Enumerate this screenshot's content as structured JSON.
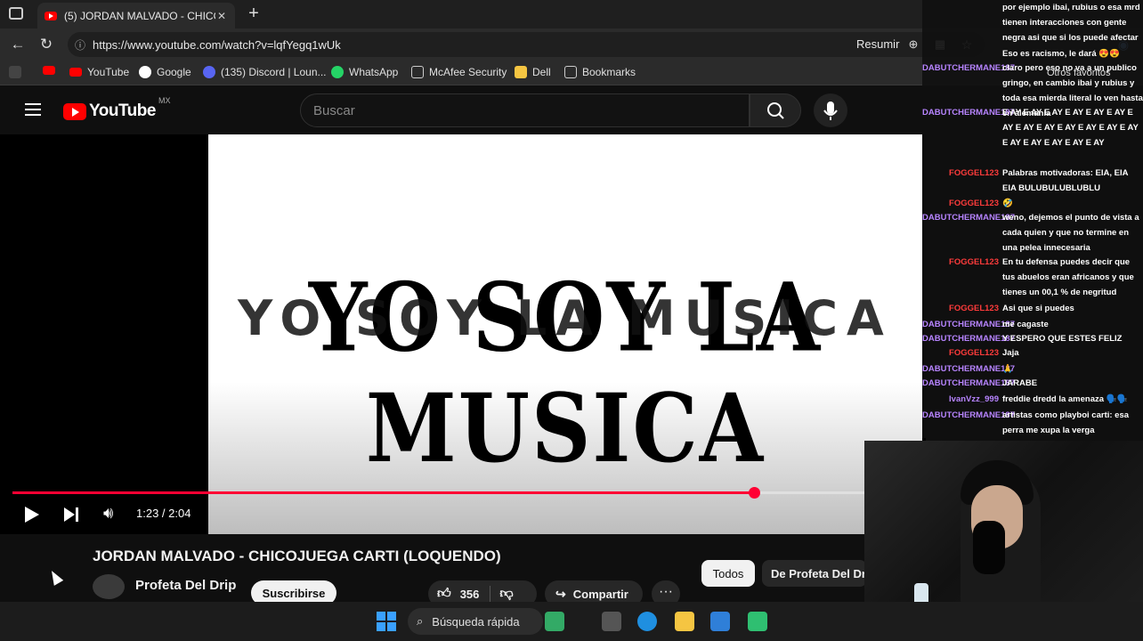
{
  "browser": {
    "tab_title": "(5) JORDAN MALVADO - CHICOJU",
    "tab_close": "✕",
    "new_tab": "+",
    "url": "https://www.youtube.com/watch?v=lqfYegq1wUk",
    "reader_label": "Resumir",
    "bookmarks": [
      "YouTube",
      "Google",
      "(135) Discord | Loun...",
      "WhatsApp",
      "McAfee Security",
      "Dell",
      "Bookmarks"
    ],
    "other_favorites": "Otros favoritos"
  },
  "youtube": {
    "logo_text": "YouTube",
    "country_code": "MX",
    "search_placeholder": "Buscar",
    "video_text_top": "YO SOY LA MUSICA",
    "video_text_overlay": "YO SOY LA MUSICA",
    "time": "1:23 / 2:04",
    "progress_fraction": 0.87,
    "video_title": "JORDAN MALVADO - CHICOJUEGA CARTI (LOQUENDO)",
    "channel": "Profeta Del Drip",
    "subscribe": "Suscribirse",
    "likes": "356",
    "share": "Compartir",
    "more": "···",
    "chip_all": "Todos",
    "chip_channel": "De Profeta Del Drip"
  },
  "chat": {
    "messages": [
      {
        "user": "",
        "text": "por ejemplo ibai, rubius o esa mrd tienen interacciones con gente negra asi que si los puede afectar",
        "color": "#fff"
      },
      {
        "user": "",
        "text": "Eso es racismo, le dará 😍😍",
        "color": "#fff"
      },
      {
        "user": "DABUTCHERMANE187",
        "text": "claro pero eso no va a un publico gringo, en cambio ibai y rubius y toda esa mierda literal lo ven hasta en alemania",
        "color": "#b784ff"
      },
      {
        "user": "DABUTCHERMANE187",
        "text": "E AY E AY E AY E AY E AY E AY E AY E AY E AY E AY E AY E AY E AY E AY E AY E AY E AY E AY",
        "color": "#b784ff"
      },
      {
        "user": "FOGGEL123",
        "text": "Palabras motivadoras: EIA, EIA EIA BULUBULUBLUBLU",
        "color": "#ff3b3b"
      },
      {
        "user": "FOGGEL123",
        "text": "🤣",
        "color": "#ff3b3b"
      },
      {
        "user": "DABUTCHERMANE187",
        "text": "weno, dejemos el punto de vista a cada quien y que no termine en una pelea innecesaria",
        "color": "#b784ff"
      },
      {
        "user": "FOGGEL123",
        "text": "En tu defensa puedes decir que tus abuelos eran africanos y que tienes un 00,1 % de negritud",
        "color": "#ff3b3b"
      },
      {
        "user": "FOGGEL123",
        "text": "Asi que si puedes",
        "color": "#ff3b3b"
      },
      {
        "user": "DABUTCHERMANE187",
        "text": "me cagaste",
        "color": "#b784ff"
      },
      {
        "user": "DABUTCHERMANE187",
        "text": "Y ESPERO QUE ESTES FELIZ",
        "color": "#b784ff"
      },
      {
        "user": "FOGGEL123",
        "text": "Jaja",
        "color": "#ff3b3b"
      },
      {
        "user": "DABUTCHERMANE187",
        "text": "🙏",
        "color": "#b784ff"
      },
      {
        "user": "DABUTCHERMANE187",
        "text": "JARABE",
        "color": "#b784ff"
      },
      {
        "user": "IvanVzz_999",
        "text": "freddie dredd la amenaza 🗣️🗣️",
        "color": "#b784ff"
      },
      {
        "user": "DABUTCHERMANE187",
        "text": "artistas como playboi carti: esa perra me xupa la verga",
        "color": "#b784ff"
      }
    ]
  },
  "taskbar": {
    "search_label": "Búsqueda rápida"
  },
  "colors": {
    "accent_red": "#ff0033",
    "chat_user_purple": "#b784ff",
    "chat_user_red": "#ff3b3b"
  }
}
